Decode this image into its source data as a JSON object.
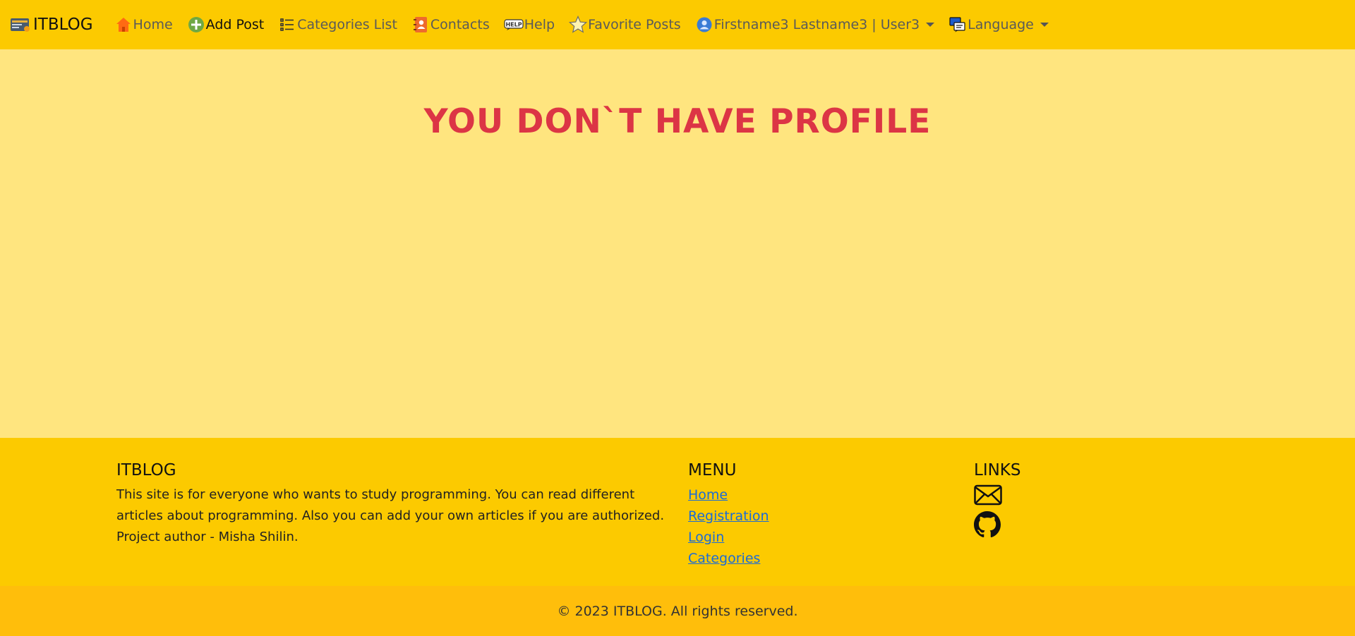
{
  "navbar": {
    "brand": "ITBLOG",
    "items": [
      {
        "label": "Home",
        "icon": "house-icon"
      },
      {
        "label": "Add Post",
        "icon": "plus-circle-icon"
      },
      {
        "label": "Categories List",
        "icon": "list-icon"
      },
      {
        "label": "Contacts",
        "icon": "contacts-book-icon"
      },
      {
        "label": "Help",
        "icon": "help-icon"
      },
      {
        "label": "Favorite Posts",
        "icon": "star-icon"
      },
      {
        "label": "Firstname3 Lastname3 | User3",
        "icon": "user-icon"
      },
      {
        "label": "Language",
        "icon": "language-icon"
      }
    ]
  },
  "main": {
    "heading": "YOU DON`T HAVE PROFILE"
  },
  "footer": {
    "about": {
      "title": "ITBLOG",
      "text": "This site is for everyone who wants to study programming. You can read different articles about programming. Also you can add your own articles if you are authorized. Project author - Misha Shilin."
    },
    "menu": {
      "title": "MENU",
      "links": [
        "Home",
        "Registration",
        "Login",
        "Categories"
      ]
    },
    "links": {
      "title": "LINKS",
      "icons": [
        "envelope-icon",
        "github-icon"
      ]
    },
    "copyright": "© 2023 ITBLOG. All rights reserved."
  },
  "colors": {
    "navbar": "#fcca00",
    "page_background": "#ffe57f",
    "heading": "#dc3545",
    "copyright_bar": "#ffbe0b",
    "link": "#1a6bd8"
  }
}
